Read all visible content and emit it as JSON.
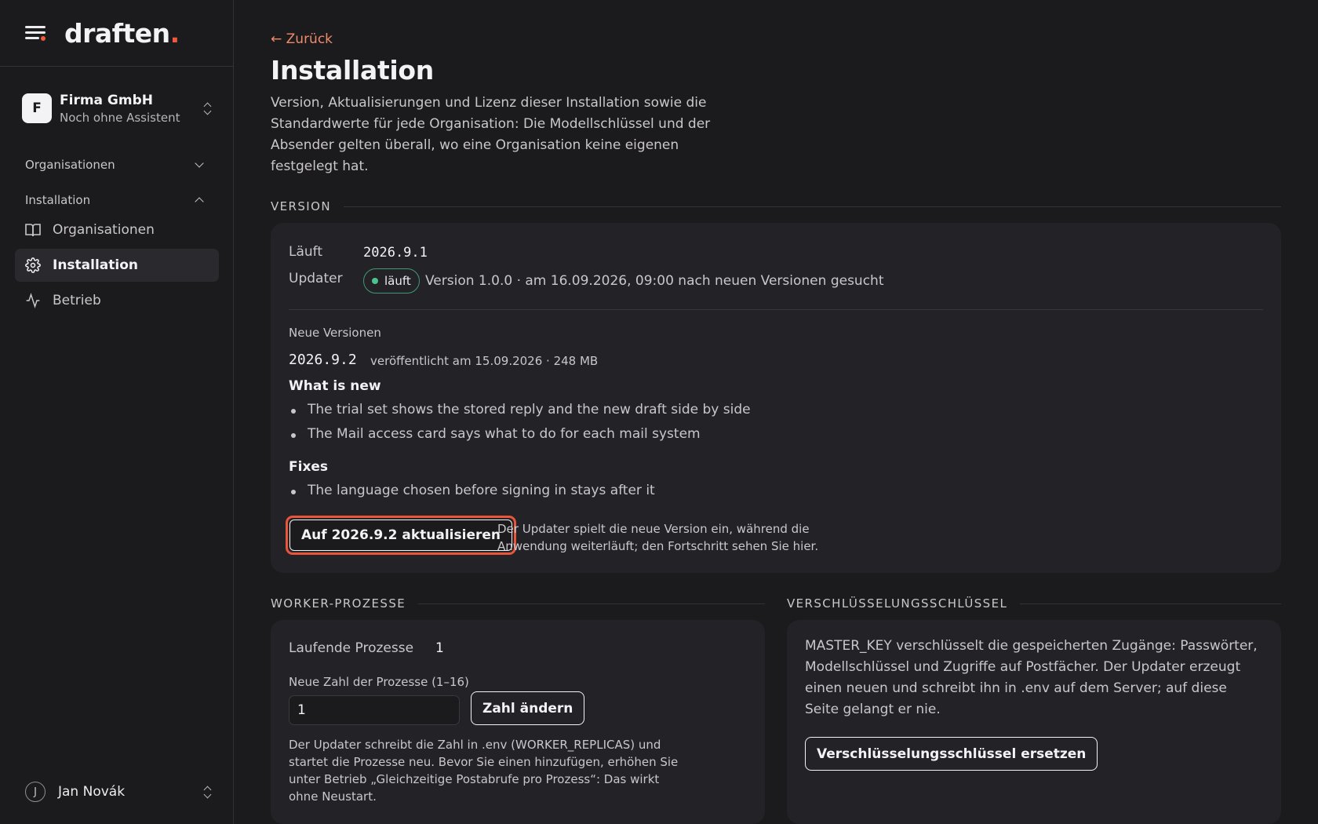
{
  "brand": {
    "name": "draften",
    "dot": "."
  },
  "org": {
    "initial": "F",
    "name": "Firma GmbH",
    "subtitle": "Noch ohne Assistent"
  },
  "sidebar": {
    "groups": [
      {
        "label": "Organisationen",
        "expanded": false
      },
      {
        "label": "Installation",
        "expanded": true
      }
    ],
    "items": [
      {
        "label": "Organisationen",
        "icon": "book-icon"
      },
      {
        "label": "Installation",
        "icon": "gear-icon",
        "active": true
      },
      {
        "label": "Betrieb",
        "icon": "activity-icon"
      }
    ]
  },
  "user": {
    "initial": "J",
    "name": "Jan Novák"
  },
  "page": {
    "back_label": "← Zurück",
    "title": "Installation",
    "description": "Version, Aktualisierungen und Lizenz dieser Installation sowie die Standardwerte für jede Organisation: Die Modellschlüssel und der Absender gelten überall, wo eine Organisation keine eigenen festgelegt hat."
  },
  "version": {
    "section_label": "VERSION",
    "running_label": "Läuft",
    "running_value": "2026.9.1",
    "updater_label": "Updater",
    "updater_status": "läuft",
    "updater_info": "Version 1.0.0 · am 16.09.2026, 09:00 nach neuen Versionen gesucht",
    "new_versions_label": "Neue Versionen",
    "new_version": "2026.9.2",
    "new_version_meta": "veröffentlicht am 15.09.2026 · 248 MB",
    "whats_new_title": "What is new",
    "whats_new": [
      "The trial set shows the stored reply and the new draft side by side",
      "The Mail access card says what to do for each mail system"
    ],
    "fixes_title": "Fixes",
    "fixes": [
      "The language chosen before signing in stays after it"
    ],
    "update_button": "Auf 2026.9.2 aktualisieren",
    "update_hint": "Der Updater spielt die neue Version ein, während die Anwendung weiterläuft; den Fortschritt sehen Sie hier."
  },
  "workers": {
    "section_label": "WORKER-PROZESSE",
    "running_label": "Laufende Prozesse",
    "running_value": "1",
    "input_label": "Neue Zahl der Prozesse (1–16)",
    "input_value": "1",
    "change_button": "Zahl ändern",
    "hint": "Der Updater schreibt die Zahl in .env (WORKER_REPLICAS) und startet die Prozesse neu. Bevor Sie einen hinzufügen, erhöhen Sie unter Betrieb „Gleichzeitige Postabrufe pro Prozess“: Das wirkt ohne Neustart."
  },
  "encryption": {
    "section_label": "VERSCHLÜSSELUNGSSCHLÜSSEL",
    "description": "MASTER_KEY verschlüsselt die gespeicherten Zugänge: Passwörter, Modellschlüssel und Zugriffe auf Postfächer. Der Updater erzeugt einen neuen und schreibt ihn in .env auf dem Server; auf diese Seite gelangt er nie.",
    "replace_button": "Verschlüsselungsschlüssel ersetzen"
  },
  "colors": {
    "accent": "#ef5a3c",
    "status_ok": "#4cc38a",
    "background": "#1b1a1d",
    "card": "#232226"
  }
}
